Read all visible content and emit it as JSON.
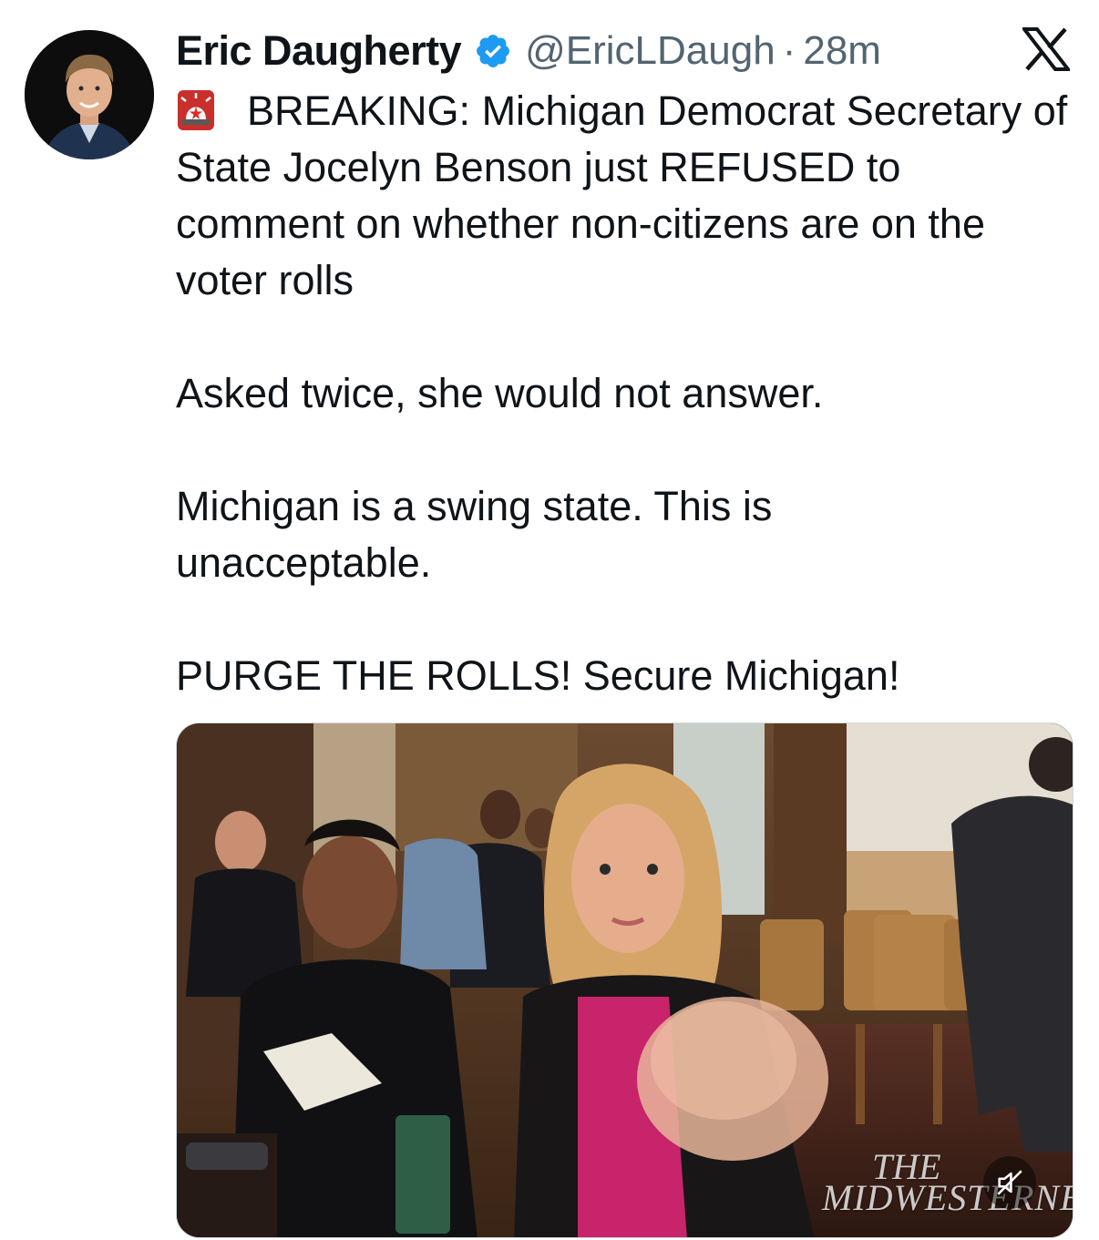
{
  "author": {
    "name": "Eric Daugherty",
    "handle": "@EricLDaugh",
    "separator": "·",
    "time": "28m",
    "verified": true,
    "avatar_icon": "profile-photo"
  },
  "platform_icon": "x-logo-icon",
  "tweet": {
    "emoji": "siren-emoji",
    "line1": "BREAKING: Michigan Democrat Secretary of State Jocelyn Benson just REFUSED to comment on whether non-citizens are on the voter rolls",
    "line2": "Asked twice, she would not answer.",
    "line3": "Michigan is a swing state. This is unacceptable.",
    "line4": "PURGE THE ROLLS! Secure Michigan!"
  },
  "media": {
    "type": "video",
    "watermark_line1": "THE",
    "watermark_line2": "MIDWESTERNER",
    "mute_icon": "speaker-muted-icon"
  },
  "colors": {
    "text": "#0f1419",
    "secondary": "#536471",
    "verified_blue": "#1d9bf0"
  }
}
